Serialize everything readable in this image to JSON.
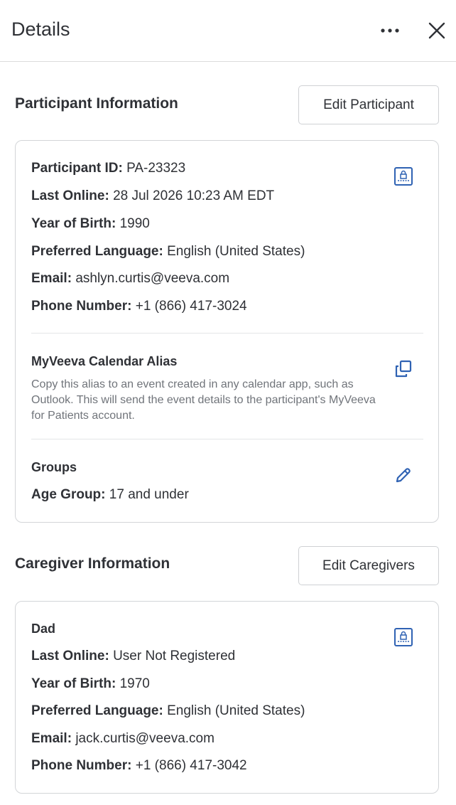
{
  "header": {
    "title": "Details",
    "more_icon": "more-horizontal-icon",
    "close_icon": "close-icon"
  },
  "participant": {
    "section_title": "Participant Information",
    "edit_label": "Edit Participant",
    "id_label": "Participant ID:",
    "id_value": "PA-23323",
    "last_online_label": "Last Online:",
    "last_online_value": "28 Jul 2026 10:23 AM EDT",
    "yob_label": "Year of Birth:",
    "yob_value": "1990",
    "language_label": "Preferred Language:",
    "language_value": "English (United States)",
    "email_label": "Email:",
    "email_value": "ashlyn.curtis@veeva.com",
    "phone_label": "Phone Number:",
    "phone_value": "+1 (866) 417-3024",
    "alias_title": "MyVeeva Calendar Alias",
    "alias_desc": "Copy this alias to an event created in any calendar app, such as Outlook. This will send the event details to the participant's MyVeeva for Patients account.",
    "groups_title": "Groups",
    "age_group_label": "Age Group:",
    "age_group_value": "17 and under"
  },
  "caregiver": {
    "section_title": "Caregiver Information",
    "edit_label": "Edit Caregivers",
    "name": "Dad",
    "last_online_label": "Last Online:",
    "last_online_value": "User Not Registered",
    "yob_label": "Year of Birth:",
    "yob_value": "1970",
    "language_label": "Preferred Language:",
    "language_value": "English (United States)",
    "email_label": "Email:",
    "email_value": "jack.curtis@veeva.com",
    "phone_label": "Phone Number:",
    "phone_value": "+1 (866) 417-3042"
  },
  "colors": {
    "accent": "#2f62b3",
    "text": "#2f3136",
    "muted": "#70747a",
    "border": "#d3d5d8"
  }
}
